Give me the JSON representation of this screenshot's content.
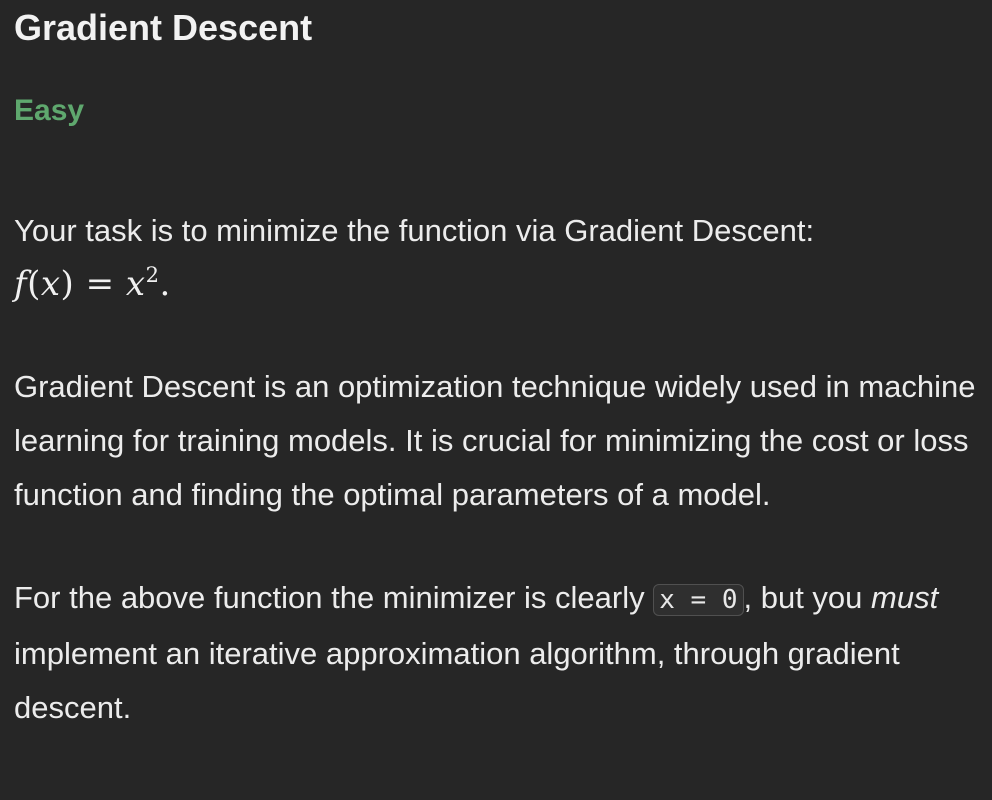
{
  "problem": {
    "title": "Gradient Descent",
    "difficulty": "Easy",
    "task_intro": "Your task is to minimize the function via Gradient Descent:",
    "formula": {
      "lhs_func": "f",
      "lhs_open": "(",
      "lhs_var": "x",
      "lhs_close": ")",
      "equals": " = ",
      "rhs_var": "x",
      "rhs_exp": "2",
      "end": "."
    },
    "paragraph1": "Gradient Descent is an optimization technique widely used in machine learning for training models. It is crucial for minimizing the cost or loss function and finding the optimal parameters of a model.",
    "paragraph2": {
      "before_code": "For the above function the minimizer is clearly ",
      "code": "x = 0",
      "after_code": ", but you ",
      "emphasis": "must",
      "rest": " implement an iterative approximation algorithm, through gradient descent."
    }
  },
  "colors": {
    "background": "#262626",
    "difficulty_easy": "#5fa86e",
    "text": "#ececec"
  }
}
